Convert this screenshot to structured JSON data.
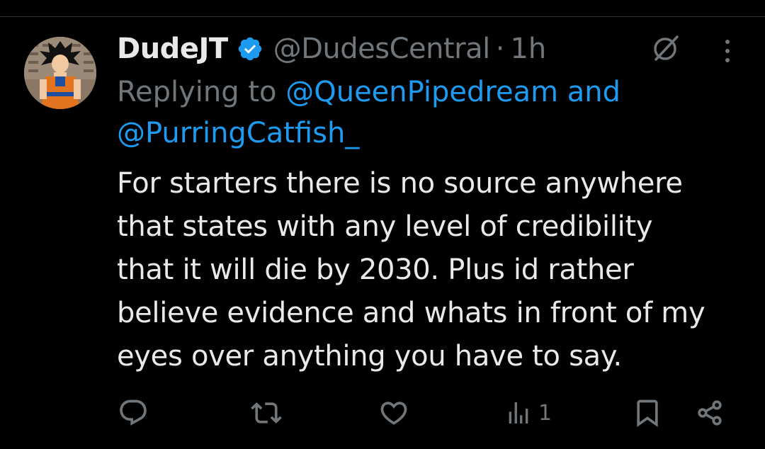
{
  "post": {
    "author": {
      "display_name": "DudeJT",
      "verified": true,
      "handle": "@DudesCentral",
      "separator": "·",
      "time": "1h"
    },
    "reply": {
      "prefix": "Replying to",
      "mention_1": "@QueenPipedream",
      "conjunction": "and",
      "mention_2": "@PurringCatfish_"
    },
    "text_lines": [
      "For starters there is no source anywhere",
      "that states with any level of credibility",
      "that it will die by 2030. Plus id rather",
      "believe evidence and whats in front of my",
      "eyes over anything you have to say."
    ],
    "metrics": {
      "views": "1"
    }
  },
  "icons": {
    "verified": "verified-badge-icon",
    "grok": "grok-icon",
    "more": "more-vertical-icon",
    "reply": "reply-icon",
    "repost": "repost-icon",
    "like": "like-icon",
    "views": "views-icon",
    "bookmark": "bookmark-icon",
    "share": "share-icon"
  },
  "colors": {
    "background": "#000000",
    "text_primary": "#e7e9ea",
    "text_secondary": "#71767b",
    "accent": "#1d9bf0",
    "divider": "#2f3336"
  }
}
